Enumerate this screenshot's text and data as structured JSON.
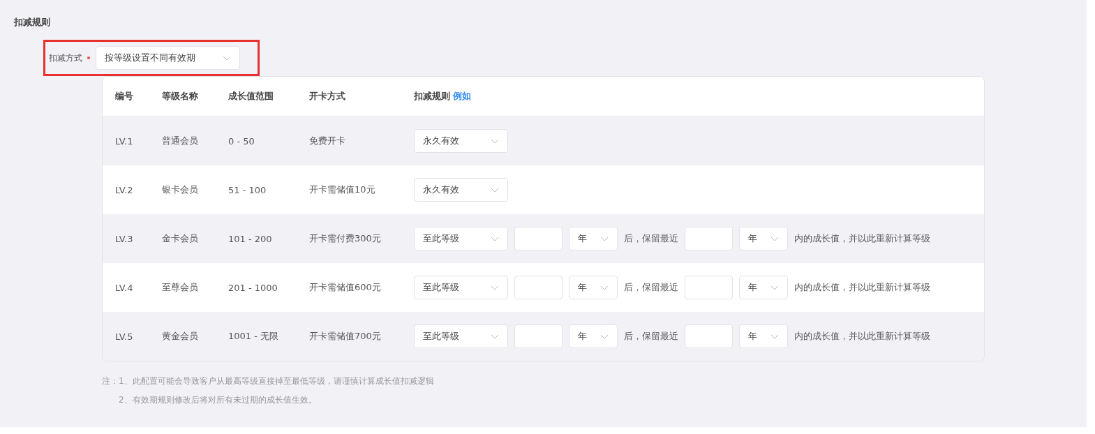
{
  "section_title": "扣减规则",
  "deduction_method": {
    "label": "扣减方式",
    "required": true,
    "value": "按等级设置不同有效期",
    "highlighted": true
  },
  "table": {
    "columns": [
      "编号",
      "等级名称",
      "成长值范围",
      "开卡方式",
      "扣减规则"
    ],
    "column_link": "例如",
    "rows": [
      {
        "id": "LV.1",
        "name": "普通会员",
        "range": "0 - 50",
        "card_method": "免费开卡",
        "rule": {
          "kind": "simple",
          "mode": "永久有效"
        }
      },
      {
        "id": "LV.2",
        "name": "银卡会员",
        "range": "51 - 100",
        "card_method": "开卡需储值10元",
        "rule": {
          "kind": "simple",
          "mode": "永久有效"
        }
      },
      {
        "id": "LV.3",
        "name": "金卡会员",
        "range": "101 - 200",
        "card_method": "开卡需付费300元",
        "rule": {
          "kind": "period",
          "mode": "至此等级",
          "unit_1": "年",
          "text_1": "后，保留最近",
          "unit_2": "年",
          "text_2": "内的成长值，并以此重新计算等级"
        }
      },
      {
        "id": "LV.4",
        "name": "至尊会员",
        "range": "201 - 1000",
        "card_method": "开卡需储值600元",
        "rule": {
          "kind": "period",
          "mode": "至此等级",
          "unit_1": "年",
          "text_1": "后，保留最近",
          "unit_2": "年",
          "text_2": "内的成长值，并以此重新计算等级"
        }
      },
      {
        "id": "LV.5",
        "name": "黄金会员",
        "range": "1001 - 无限",
        "card_method": "开卡需储值700元",
        "rule": {
          "kind": "period",
          "mode": "至此等级",
          "unit_1": "年",
          "text_1": "后，保留最近",
          "unit_2": "年",
          "text_2": "内的成长值，并以此重新计算等级"
        }
      }
    ]
  },
  "notes": {
    "label": "注：",
    "items": [
      "1、此配置可能会导致客户从最高等级直接掉至最低等级，请谨慎计算成长值扣减逻辑",
      "2、有效期规则修改后将对所有未过期的成长值生效。"
    ]
  }
}
